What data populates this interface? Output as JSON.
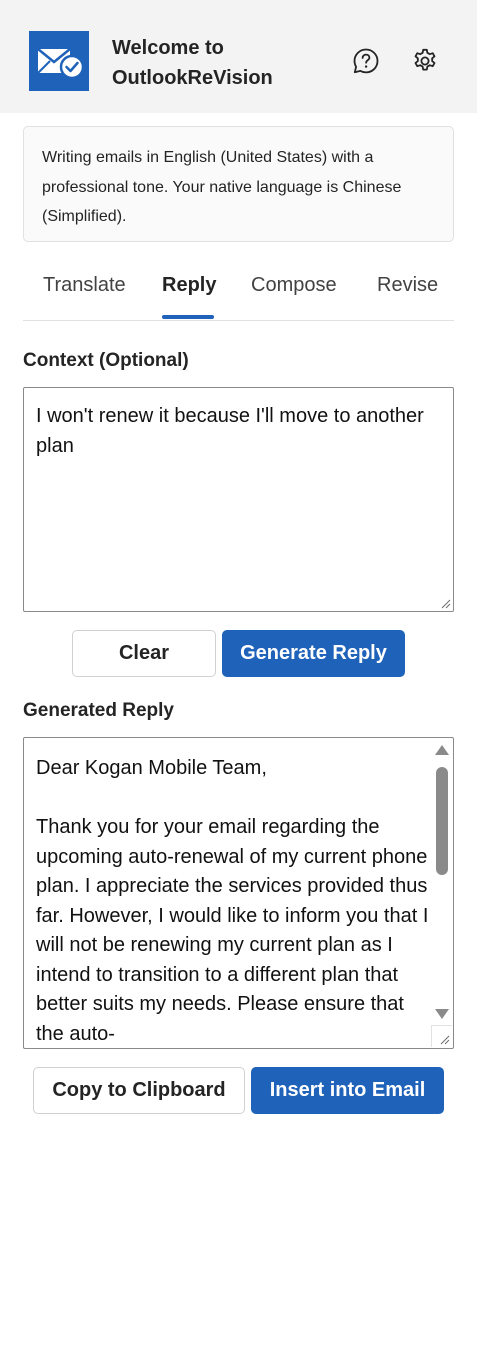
{
  "header": {
    "title": "Welcome to OutlookReVision",
    "logo_icon": "mail-check-icon",
    "help_icon": "help-icon",
    "settings_icon": "gear-icon",
    "brand_color": "#1f62b9"
  },
  "info": {
    "text": "Writing emails in English (United States) with a professional tone. Your native language is Chinese (Simplified)."
  },
  "tabs": [
    {
      "label": "Translate",
      "active": false
    },
    {
      "label": "Reply",
      "active": true
    },
    {
      "label": "Compose",
      "active": false
    },
    {
      "label": "Revise",
      "active": false
    }
  ],
  "context": {
    "label": "Context (Optional)",
    "value": "I won't renew it because I'll move to another plan"
  },
  "actions": {
    "clear_label": "Clear",
    "generate_label": "Generate Reply"
  },
  "generated": {
    "label": "Generated Reply",
    "value": "Dear Kogan Mobile Team,\n\nThank you for your email regarding the upcoming auto-renewal of my current phone plan. I appreciate the services provided thus far. However, I would like to inform you that I will not be renewing my current plan as I intend to transition to a different plan that better suits my needs. Please ensure that the auto-"
  },
  "output_actions": {
    "copy_label": "Copy to Clipboard",
    "insert_label": "Insert into Email"
  }
}
